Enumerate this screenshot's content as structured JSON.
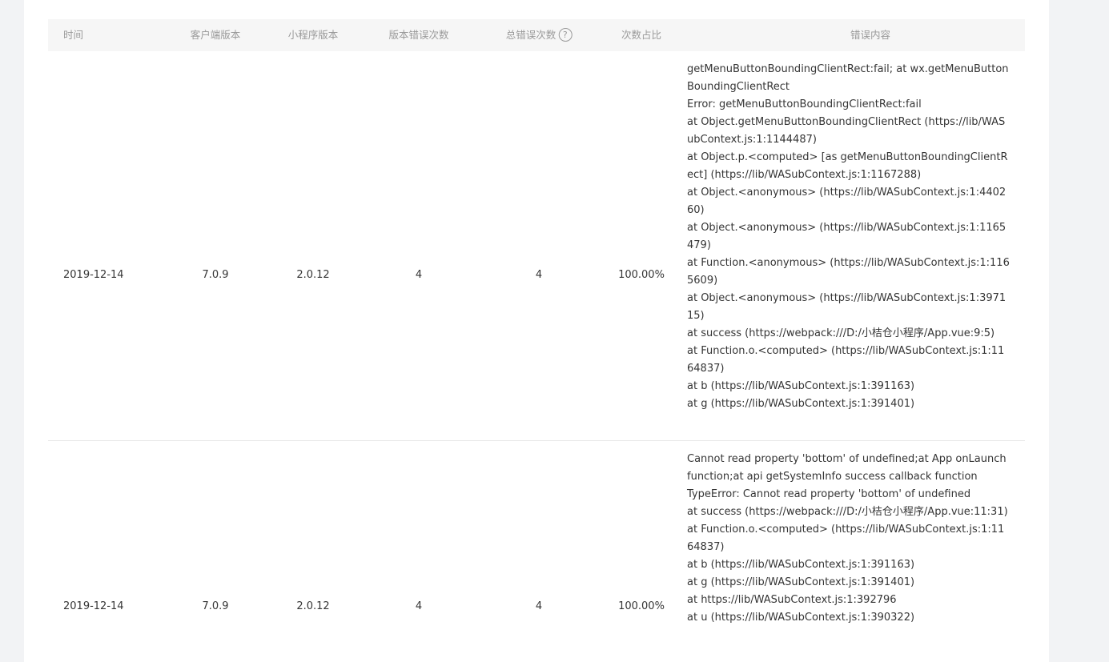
{
  "table": {
    "headers": {
      "time": "时间",
      "client_version": "客户端版本",
      "app_version": "小程序版本",
      "version_error_count": "版本错误次数",
      "total_error_count": "总错误次数",
      "ratio": "次数占比",
      "error_content": "错误内容"
    },
    "help_icon": "?",
    "rows": [
      {
        "time": "2019-12-14",
        "client_version": "7.0.9",
        "app_version": "2.0.12",
        "version_error_count": "4",
        "total_error_count": "4",
        "ratio": "100.00%",
        "error_lines": [
          "getMenuButtonBoundingClientRect:fail; at wx.getMenuButtonBoundingClientRect",
          "Error: getMenuButtonBoundingClientRect:fail",
          "at Object.getMenuButtonBoundingClientRect (https://lib/WASubContext.js:1:1144487)",
          "at Object.p.<computed> [as getMenuButtonBoundingClientRect] (https://lib/WASubContext.js:1:1167288)",
          "at Object.<anonymous> (https://lib/WASubContext.js:1:440260)",
          "at Object.<anonymous> (https://lib/WASubContext.js:1:1165479)",
          "at Function.<anonymous> (https://lib/WASubContext.js:1:1165609)",
          "at Object.<anonymous> (https://lib/WASubContext.js:1:397115)",
          "at success (https://webpack:///D:/小桔仓小程序/App.vue:9:5)",
          "at Function.o.<computed> (https://lib/WASubContext.js:1:1164837)",
          "at b (https://lib/WASubContext.js:1:391163)",
          "at g (https://lib/WASubContext.js:1:391401)"
        ]
      },
      {
        "time": "2019-12-14",
        "client_version": "7.0.9",
        "app_version": "2.0.12",
        "version_error_count": "4",
        "total_error_count": "4",
        "ratio": "100.00%",
        "error_lines": [
          "Cannot read property 'bottom' of undefined;at App onLaunch function;at api getSystemInfo success callback function",
          "TypeError: Cannot read property 'bottom' of undefined",
          "at success (https://webpack:///D:/小桔仓小程序/App.vue:11:31)",
          "at Function.o.<computed> (https://lib/WASubContext.js:1:1164837)",
          "at b (https://lib/WASubContext.js:1:391163)",
          "at g (https://lib/WASubContext.js:1:391401)",
          "at https://lib/WASubContext.js:1:392796",
          "at u (https://lib/WASubContext.js:1:390322)"
        ]
      }
    ]
  }
}
